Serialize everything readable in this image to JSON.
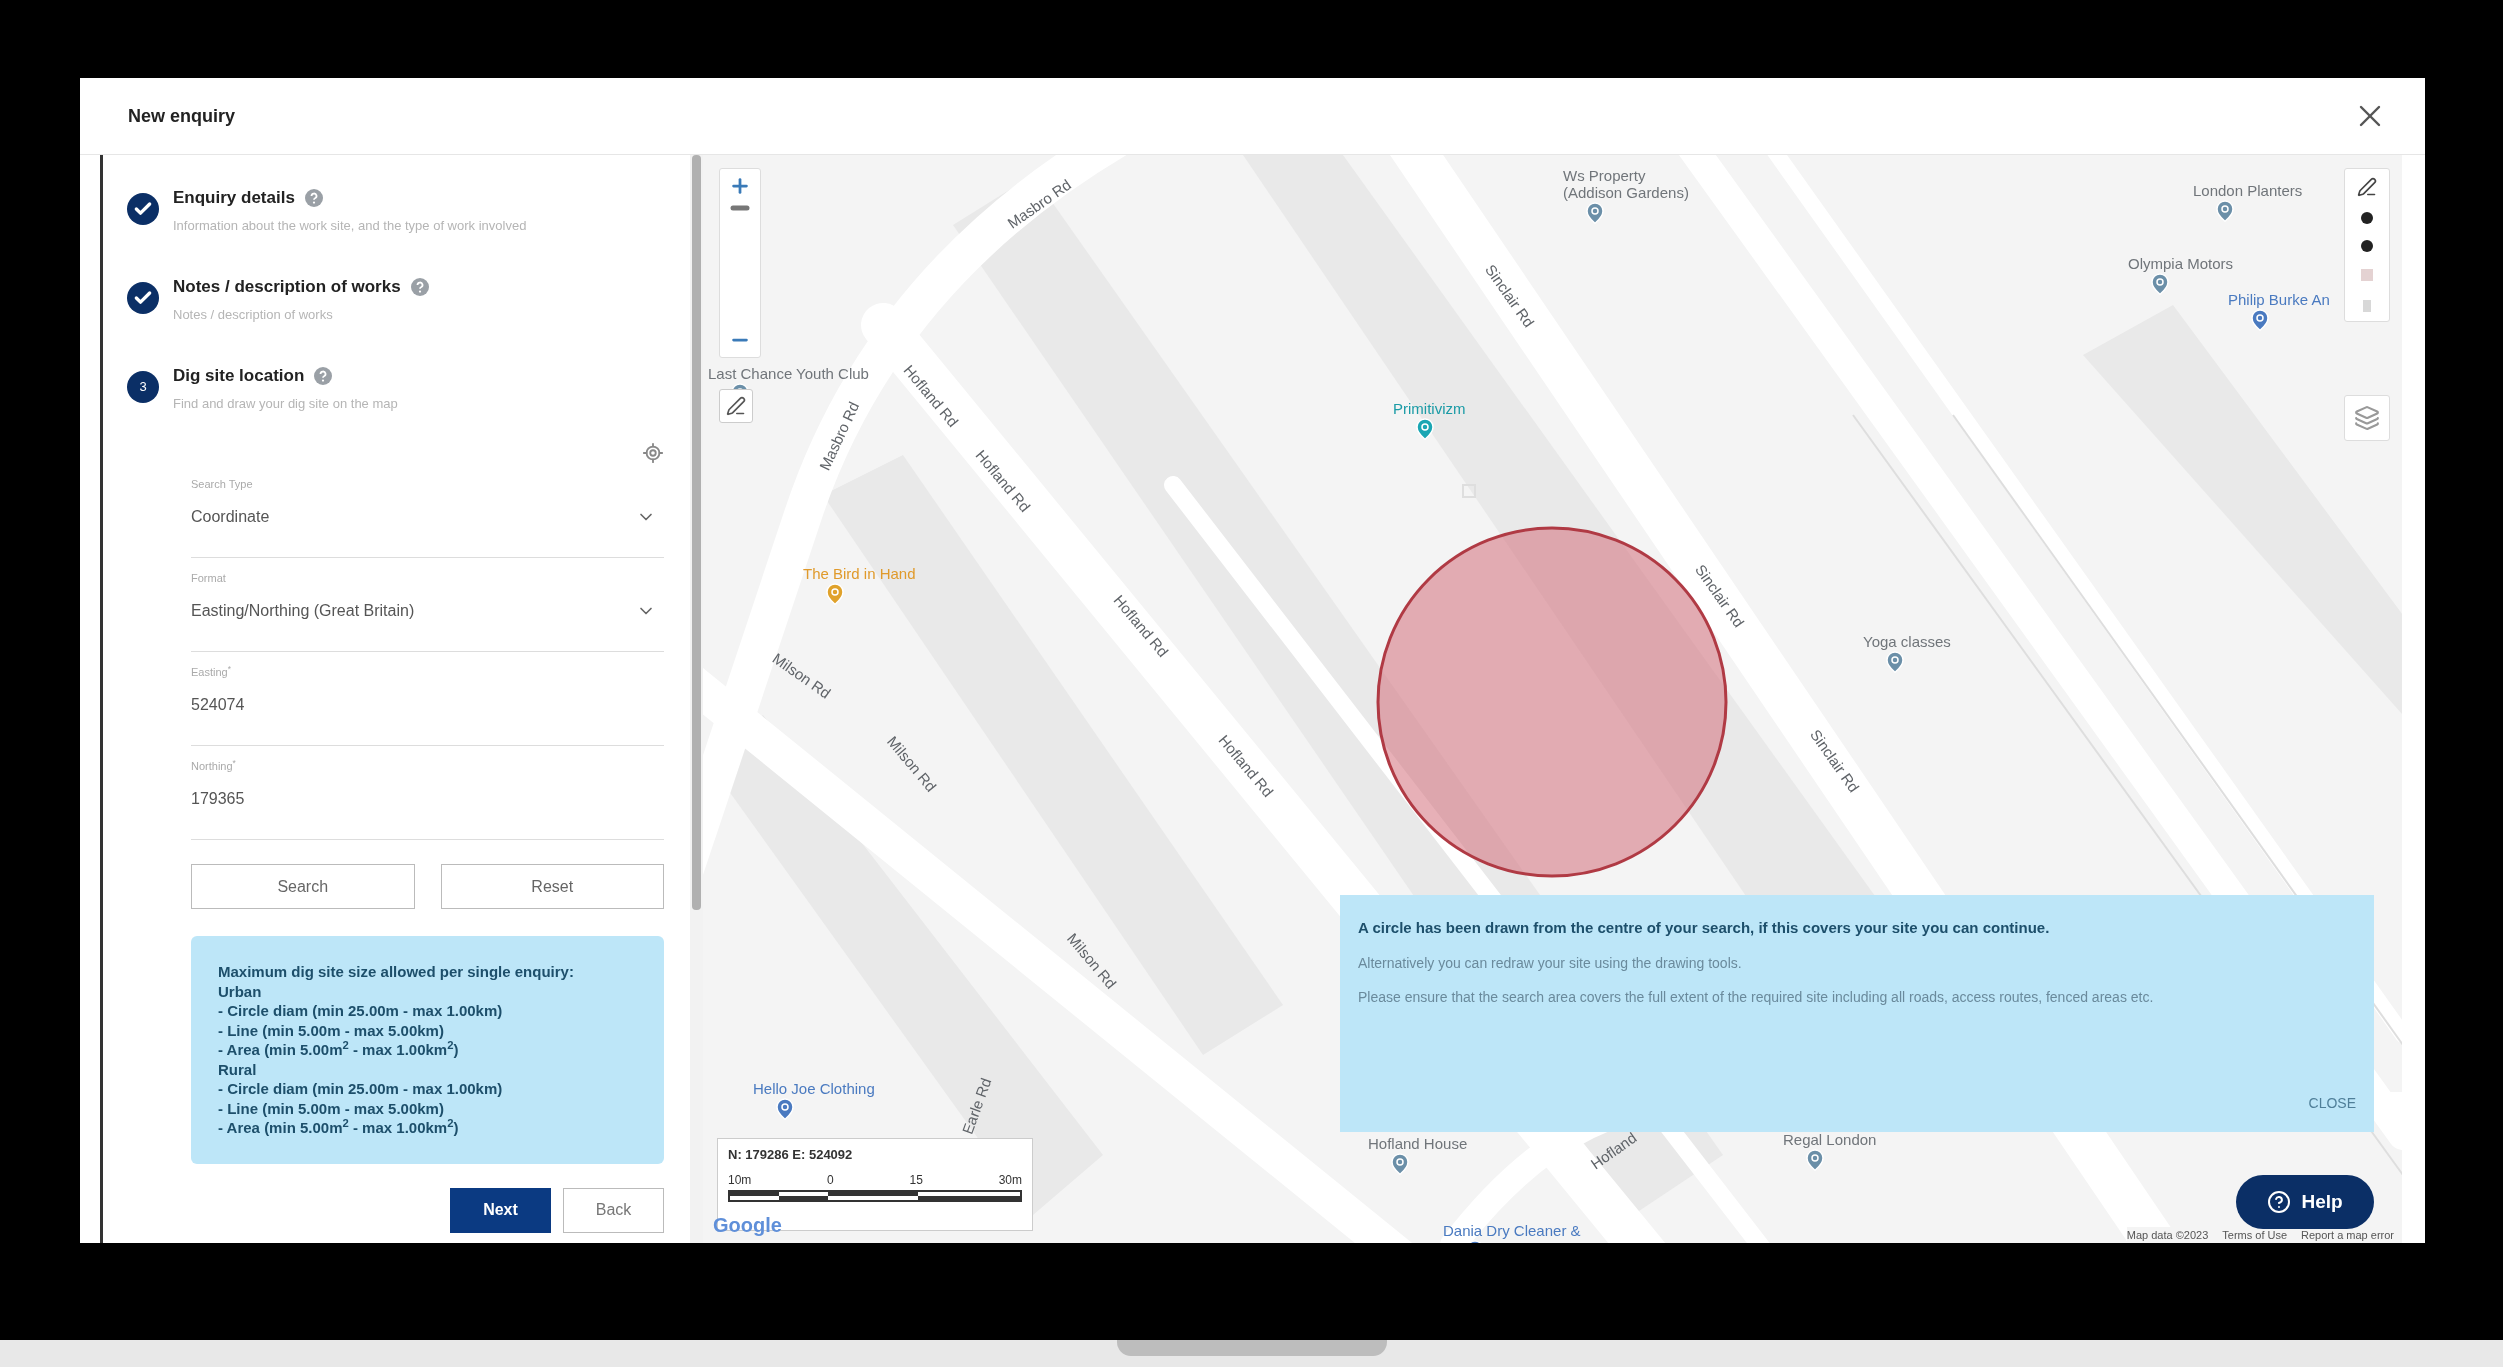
{
  "window": {
    "title": "New enquiry"
  },
  "steps": [
    {
      "title": "Enquiry details",
      "description": "Information about the work site, and the type of work involved",
      "completed": true
    },
    {
      "title": "Notes / description of works",
      "description": "Notes / description of works",
      "completed": true
    },
    {
      "title": "Dig site location",
      "description": "Find and draw your dig site on the map",
      "completed": false,
      "number": "3"
    }
  ],
  "form": {
    "fields": [
      {
        "kind": "select",
        "label": "Search Type",
        "value": "Coordinate"
      },
      {
        "kind": "select",
        "label": "Format",
        "value": "Easting/Northing (Great Britain)"
      },
      {
        "kind": "text",
        "label": "Easting$^{*}$",
        "value": "524074"
      },
      {
        "kind": "text",
        "label": "Northing$^{*}$",
        "value": "179365"
      }
    ],
    "buttons": [
      "Search",
      "Reset"
    ]
  },
  "limits": {
    "title": "Maximum dig site size allowed per single enquiry:",
    "groups": [
      {
        "name": "Urban",
        "lines": [
          "- Circle diam (min 25.00m - max 1.00km)",
          "- Line (min 5.00m - max 5.00km)",
          "- Area (min 5.00m$^{2}$ - max 1.00km$^{2}$)"
        ]
      },
      {
        "name": "Rural",
        "lines": [
          "- Circle diam (min 25.00m - max 1.00km)",
          "- Line (min 5.00m - max 5.00km)",
          "- Area (min 5.00m$^{2}$ - max 1.00km$^{2}$)"
        ]
      }
    ]
  },
  "nav_buttons": [
    {
      "label": "Next",
      "primary": true
    },
    {
      "label": "Back",
      "primary": false
    }
  ],
  "map": {
    "labels": [
      {
        "kind": "road",
        "text": "Masbro Rd"
      },
      {
        "kind": "place",
        "text": "Ws Property\n(Addison Gardens)"
      },
      {
        "kind": "road",
        "text": "Sinclair Rd"
      },
      {
        "kind": "place",
        "text": "London Planters"
      },
      {
        "kind": "place",
        "text": "Olympia Motors"
      },
      {
        "kind": "shop",
        "text": "Philip Burke An"
      },
      {
        "kind": "place",
        "text": "Last Chance Youth Club"
      },
      {
        "kind": "road",
        "text": "Hofland Rd"
      },
      {
        "kind": "road",
        "text": "Masbro Rd"
      },
      {
        "kind": "road",
        "text": "Hofland Rd"
      },
      {
        "kind": "health",
        "text": "Primitivizm"
      },
      {
        "kind": "food",
        "text": "The Bird in Hand"
      },
      {
        "kind": "road",
        "text": "Sinclair Rd"
      },
      {
        "kind": "road",
        "text": "Hofland Rd"
      },
      {
        "kind": "place",
        "text": "Yoga classes"
      },
      {
        "kind": "road",
        "text": "Milson Rd"
      },
      {
        "kind": "road",
        "text": "Hofland Rd"
      },
      {
        "kind": "road",
        "text": "Sinclair Rd"
      },
      {
        "kind": "road",
        "text": "Milson Rd"
      },
      {
        "kind": "road",
        "text": "Milson Rd"
      },
      {
        "kind": "shop",
        "text": "Hello Joe Clothing"
      },
      {
        "kind": "road",
        "text": "Earle Rd"
      },
      {
        "kind": "place",
        "text": "Hofland House"
      },
      {
        "kind": "road",
        "text": "Hofland"
      },
      {
        "kind": "place",
        "text": "Regal London"
      },
      {
        "kind": "shop",
        "text": "Dania Dry Cleaner &"
      }
    ],
    "notice": {
      "title": "A circle has been drawn from the centre of your search, if this covers your site you can continue.",
      "paragraphs": [
        "Alternatively you can redraw your site using the drawing tools.",
        "Please ensure that the search area covers the full extent of the required site including all roads, access routes, fenced areas etc."
      ],
      "close": "CLOSE"
    },
    "scale": {
      "coordinates": "N: 179286 E: 524092",
      "ticks": [
        "10m",
        "0",
        "15",
        "30m"
      ]
    },
    "logo": "Google",
    "attribution": [
      "Map data ©2023",
      "Terms of Use",
      "Report a map error"
    ],
    "help": "Help"
  }
}
